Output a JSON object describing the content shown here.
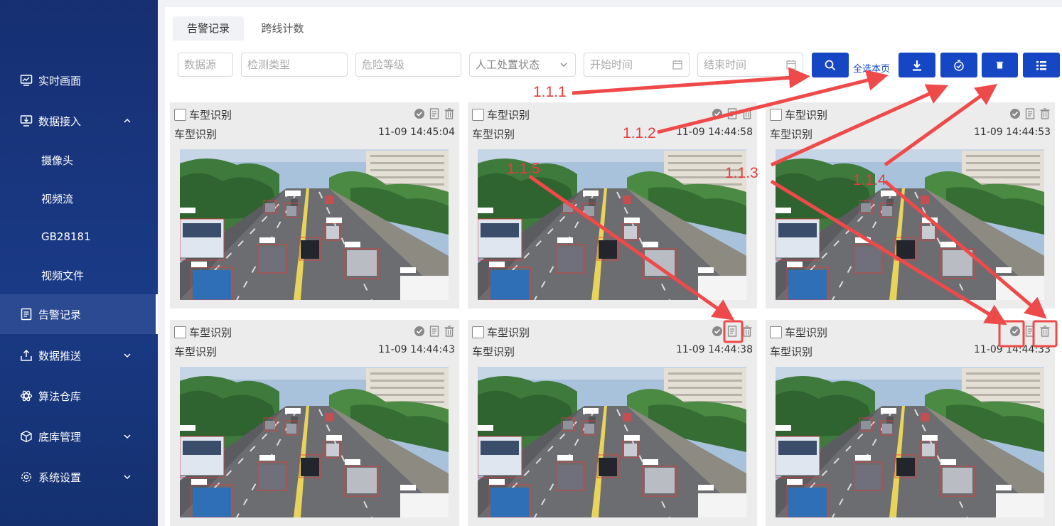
{
  "sidebar": {
    "items": [
      {
        "label": "实时画面",
        "icon": "monitor-chart-icon"
      },
      {
        "label": "数据接入",
        "icon": "data-input-icon",
        "expandable": true
      },
      {
        "label": "摄像头"
      },
      {
        "label": "视频流"
      },
      {
        "label": "GB28181"
      },
      {
        "label": "视频文件"
      },
      {
        "label": "告警记录",
        "icon": "document-icon",
        "active": true
      },
      {
        "label": "数据推送",
        "icon": "upload-icon",
        "expandable": true
      },
      {
        "label": "算法仓库",
        "icon": "atom-icon"
      },
      {
        "label": "底库管理",
        "icon": "cube-icon",
        "expandable": true
      },
      {
        "label": "系统设置",
        "icon": "gear-icon",
        "expandable": true
      }
    ]
  },
  "tabs": [
    {
      "label": "告警记录",
      "active": true
    },
    {
      "label": "跨线计数",
      "active": false
    }
  ],
  "filters": {
    "source": "数据源",
    "detect_type": "检测类型",
    "risk_level": "危险等级",
    "manual_status": "人工处置状态",
    "start_time": "开始时间",
    "end_time": "结束时间"
  },
  "toolbar": {
    "select_all": "全选本页"
  },
  "cards": [
    {
      "title": "车型识别",
      "subtitle": "车型识别",
      "time": "11-09 14:45:04"
    },
    {
      "title": "车型识别",
      "subtitle": "车型识别",
      "time": "11-09 14:44:58"
    },
    {
      "title": "车型识别",
      "subtitle": "车型识别",
      "time": "11-09 14:44:53"
    },
    {
      "title": "车型识别",
      "subtitle": "车型识别",
      "time": "11-09 14:44:43"
    },
    {
      "title": "车型识别",
      "subtitle": "车型识别",
      "time": "11-09 14:44:38"
    },
    {
      "title": "车型识别",
      "subtitle": "车型识别",
      "time": "11-09 14:44:33"
    }
  ],
  "annotations": [
    "1.1.1",
    "1.1.2",
    "1.1.3",
    "1.1.4",
    "1.1.5"
  ],
  "colors": {
    "sidebar": "#1a3a86",
    "accent": "#1546c4",
    "annotation": "#e83b3b"
  }
}
